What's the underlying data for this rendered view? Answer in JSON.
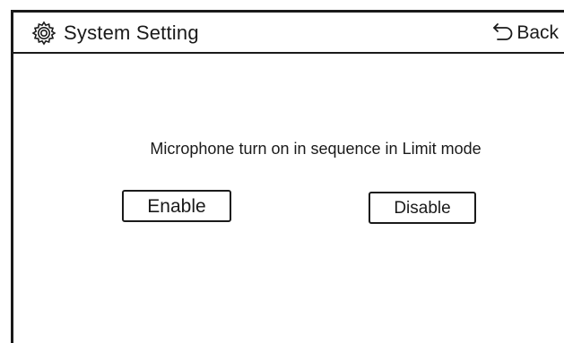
{
  "header": {
    "title": "System Setting",
    "title_icon": "gear-icon",
    "back_label": "Back",
    "back_icon": "return-arrow-icon"
  },
  "main": {
    "prompt": "Microphone turn on in sequence in Limit mode",
    "options": [
      {
        "label": "Enable"
      },
      {
        "label": "Disable"
      }
    ]
  },
  "colors": {
    "foreground": "#1a1a1a",
    "background": "#ffffff"
  }
}
